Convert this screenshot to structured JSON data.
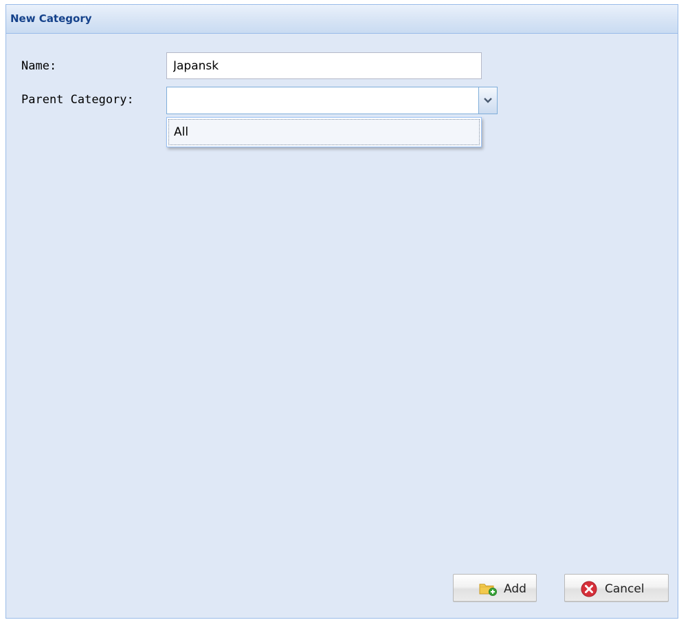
{
  "window": {
    "title": "New Category"
  },
  "form": {
    "name_label": "Name:",
    "name_value": "Japansk",
    "parent_label": "Parent Category:",
    "parent_value": "",
    "parent_options": [
      "All"
    ]
  },
  "buttons": {
    "add_label": "Add",
    "add_icon": "folder-add-icon",
    "cancel_label": "Cancel",
    "cancel_icon": "cancel-icon"
  },
  "colors": {
    "panel_background": "#dfe8f6",
    "panel_border": "#99bbe8",
    "title_text": "#15428b",
    "cancel_icon_red": "#d6303a",
    "folder_yellow": "#f2c94c",
    "add_badge_green": "#3aa53a"
  }
}
